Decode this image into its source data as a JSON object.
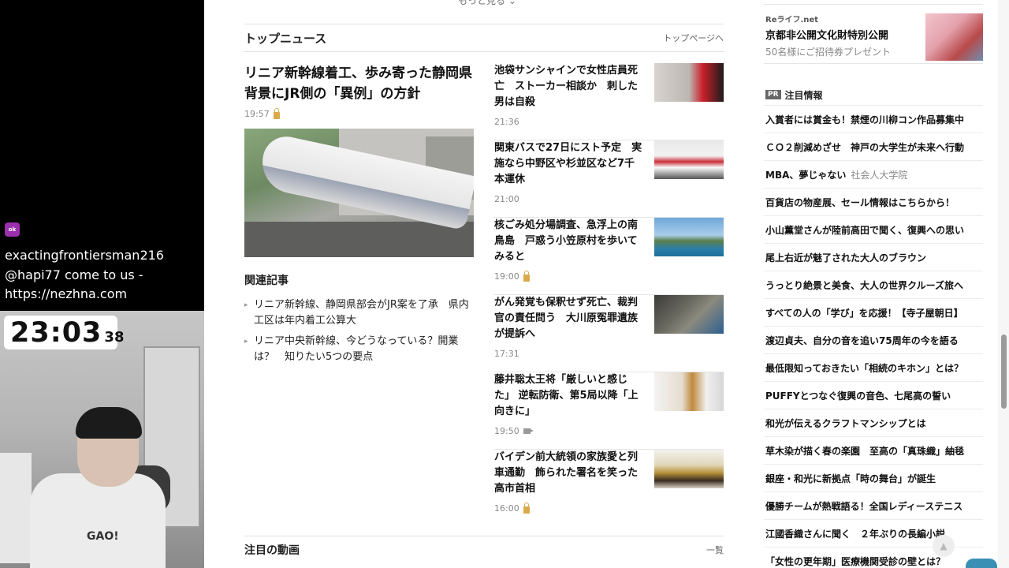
{
  "stream": {
    "chat_badge": "ok",
    "chat_user": "exactingfrontiersman216",
    "chat_message_1": "@hapi77 come to us -",
    "chat_message_2": "https://nezhna.com",
    "timer_main": "23:03",
    "timer_sub": "38",
    "shirt_text": "GAO!"
  },
  "page": {
    "more_top": "もっと見る ⌄",
    "top_news": {
      "title": "トップニュース",
      "link": "トップページへ"
    },
    "main_article": {
      "headline": "リニア新幹線着工、歩み寄った静岡県　背景にJR側の「異例」の方針",
      "time": "19:57"
    },
    "related": {
      "title": "関連記事",
      "items": [
        "リニア新幹線、静岡県部会がJR案を了承　県内工区は年内着工公算大",
        "リニア中央新幹線、今どうなっている？開業は？　知りたい5つの要点"
      ]
    },
    "side_articles": [
      {
        "headline": "池袋サンシャインで女性店員死亡　ストーカー相談か　刺した男は自殺",
        "time": "21:36",
        "icon": "none"
      },
      {
        "headline": "関東バスで27日にスト予定　実施なら中野区や杉並区など7千本運休",
        "time": "21:00",
        "icon": "none"
      },
      {
        "headline": "核ごみ処分場調査、急浮上の南鳥島　戸惑う小笠原村を歩いてみると",
        "time": "19:00",
        "icon": "lock-icon"
      },
      {
        "headline": "がん発覚も保釈せず死亡、裁判官の責任問う　大川原冤罪遺族が提訴へ",
        "time": "17:31",
        "icon": "none"
      },
      {
        "headline": "藤井聡太王将「厳しいと感じた」 逆転防衛、第5局以降「上向きに」",
        "time": "19:50",
        "icon": "video-icon"
      },
      {
        "headline": "バイデン前大統領の家族愛と列車通勤　飾られた署名を笑った高市首相",
        "time": "16:00",
        "icon": "lock-icon"
      }
    ],
    "video_section": {
      "title": "注目の動画",
      "link": "一覧"
    },
    "ad_top": {
      "source": "Reライフ.net",
      "title": "京都非公開文化財特別公開",
      "sub": "50名様にご招待券プレゼント"
    },
    "pr": {
      "badge": "PR",
      "title": "注目情報",
      "items": [
        {
          "text": "入賞者には賞金も！禁煙の川柳コン作品募集中",
          "sponsor": ""
        },
        {
          "text": "ＣＯ２削減めざせ　神戸の大学生が未来へ行動",
          "sponsor": ""
        },
        {
          "text": "MBA、夢じゃない",
          "sponsor": "社会人大学院"
        },
        {
          "text": "百貨店の物産展、セール情報はこちらから！",
          "sponsor": ""
        },
        {
          "text": "小山薫堂さんが陸前高田で聞く、復興への思い",
          "sponsor": ""
        },
        {
          "text": "尾上右近が魅了された大人のブラウン",
          "sponsor": ""
        },
        {
          "text": "うっとり絶景と美食、大人の世界クルーズ旅へ",
          "sponsor": ""
        },
        {
          "text": "すべての人の「学び」を応援！【寺子屋朝日】",
          "sponsor": ""
        },
        {
          "text": "渡辺貞夫、自分の音を追い75周年の今を語る",
          "sponsor": ""
        },
        {
          "text": "最低限知っておきたい「相続のキホン」とは？",
          "sponsor": ""
        },
        {
          "text": "PUFFYとつなぐ復興の音色、七尾高の誓い",
          "sponsor": ""
        },
        {
          "text": "和光が伝えるクラフトマンシップとは",
          "sponsor": ""
        },
        {
          "text": "草木染が描く春の楽園　至高の「真珠織」紬毯",
          "sponsor": ""
        },
        {
          "text": "銀座・和光に新拠点「時の舞台」が誕生",
          "sponsor": ""
        },
        {
          "text": "優勝チームが熱戦語る！全国レディーステニス",
          "sponsor": ""
        },
        {
          "text": "江國香織さんに聞く　２年ぶりの長編小説",
          "sponsor": ""
        },
        {
          "text": "「女性の更年期」医療機関受診の壁とは？",
          "sponsor": ""
        }
      ]
    }
  },
  "colors": {
    "accent_lock": "#d9a94a",
    "stream_bg": "#000000",
    "page_bg": "#ffffff"
  }
}
